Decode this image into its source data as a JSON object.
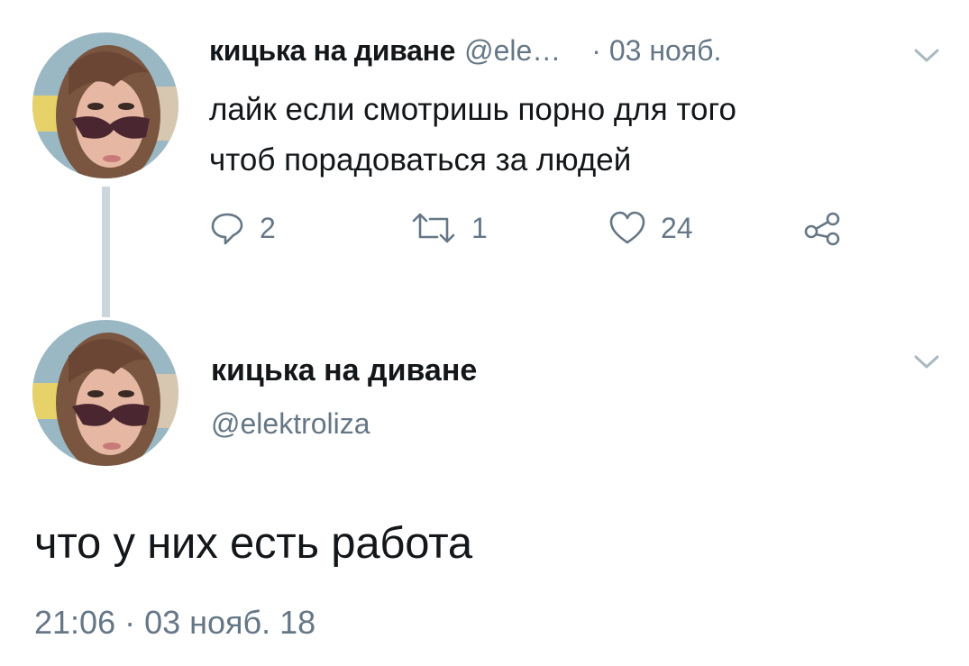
{
  "tweet1": {
    "display_name": "кицька на диване",
    "handle": "@ele…",
    "date": "· 03 нояб.",
    "text_line1": "лайк если смотришь порно для того",
    "text_line2": "чтоб порадоваться за людей",
    "replies": "2",
    "retweets": "1",
    "likes": "24"
  },
  "tweet2": {
    "display_name": "кицька на диване",
    "handle": "@elektroliza",
    "text": "что у них есть работа",
    "timestamp": "21:06 · 03 нояб. 18"
  },
  "icons": [
    "avatar",
    "chevron-down-icon",
    "reply-icon",
    "retweet-icon",
    "like-icon",
    "share-icon"
  ],
  "colors": {
    "text": "#14171a",
    "muted": "#657786",
    "thread_line": "#ccd6dd",
    "caret": "#aab8c2"
  }
}
